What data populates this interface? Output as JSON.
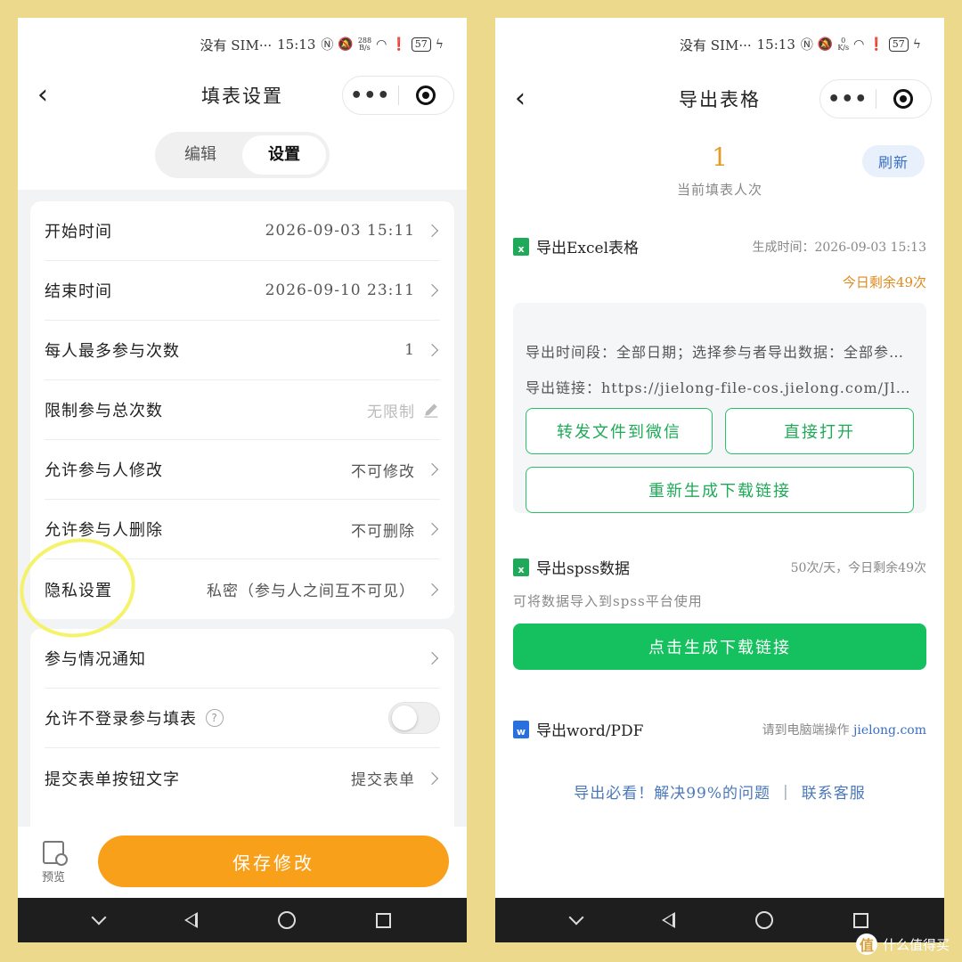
{
  "status_bar": {
    "left_carrier": "没有 SIM···",
    "time": "15:13",
    "speed_left": "288",
    "speed_unit": "B/s",
    "speed_right": "0",
    "speed_unit_right": "K/s",
    "battery": "57"
  },
  "left": {
    "title": "填表设置",
    "tabs": [
      {
        "label": "编辑"
      },
      {
        "label": "设置"
      }
    ],
    "active_tab": "设置",
    "group1": [
      {
        "label": "开始时间",
        "value": "2026-09-03  15:11"
      },
      {
        "label": "结束时间",
        "value": "2026-09-10  23:11"
      },
      {
        "label": "每人最多参与次数",
        "value": "1"
      },
      {
        "label": "限制参与总次数",
        "value": "无限制"
      },
      {
        "label": "允许参与人修改",
        "value": "不可修改"
      },
      {
        "label": "允许参与人删除",
        "value": "不可删除"
      },
      {
        "label": "隐私设置",
        "value": "私密（参与人之间互不可见）"
      }
    ],
    "group2": [
      {
        "label": "参与情况通知",
        "value": ""
      },
      {
        "label": "允许不登录参与填表",
        "value": "",
        "toggle": false,
        "help": "?"
      },
      {
        "label": "提交表单按钮文字",
        "value": "提交表单"
      }
    ],
    "preview_label": "预览",
    "save_label": "保存修改"
  },
  "right": {
    "title": "导出表格",
    "count": "1",
    "count_label": "当前填表人次",
    "refresh_label": "刷新",
    "excel": {
      "icon": "x",
      "title": "导出Excel表格",
      "meta": "生成时间：2026-09-03  15:13",
      "remain": "今日剩余49次",
      "period": "导出时间段：全部日期；选择参与者导出数据：全部参与者",
      "link": "导出链接：https://jielong-file-cos.jielong.com/Jl_Form/export.xlsx",
      "forward_label": "转发文件到微信",
      "open_label": "直接打开",
      "regen_label": "重新生成下载链接"
    },
    "spss": {
      "icon": "x",
      "title": "导出spss数据",
      "meta": "50次/天，今日剩余49次",
      "desc": "可将数据导入到spss平台使用",
      "button": "点击生成下载链接"
    },
    "word": {
      "icon": "w",
      "title": "导出word/PDF",
      "meta_prefix": "请到电脑端操作",
      "meta_link": "jielong.com"
    },
    "footer": {
      "help": "导出必看！解决99%的问题",
      "sep": "|",
      "contact": "联系客服"
    }
  },
  "watermark": {
    "logo": "值",
    "text": "什么值得买"
  },
  "colors": {
    "background": "#ecd98c",
    "accent_orange": "#f9a01b",
    "accent_green": "#14c15e",
    "highlight": "#f4f25a"
  }
}
